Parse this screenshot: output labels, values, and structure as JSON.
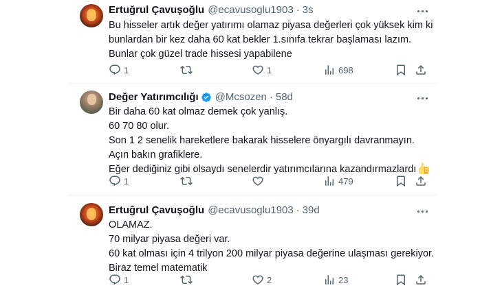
{
  "tweets": [
    {
      "name": "Ertuğrul Çavuşoğlu",
      "handle": "@ecavusoglu1903",
      "separator": "·",
      "time": "3s",
      "verified": false,
      "lines": [
        "Bu hisseler artık değer yatırımı olamaz piyasa değerleri çok yüksek kim ki",
        "bunlardan bir kez daha 60 kat bekler 1.sınıfa tekrar başlaması lazım.",
        "Bunlar çok güzel trade hissesi yapabilene"
      ],
      "replies": "1",
      "retweets": "",
      "likes": "1",
      "views": "698"
    },
    {
      "name": "Değer Yatırımcılığı",
      "handle": "@Mcsozen",
      "separator": "·",
      "time": "58d",
      "verified": true,
      "lines": [
        "Bir daha 60 kat olmaz demek çok yanlış.",
        "60 70 80 olur.",
        "Son 1 2 senelik hareketlere bakarak hisselere önyargılı davranmayın.",
        "Açın bakın grafiklere.",
        "Eğer dediğiniz gibi olsaydı senelerdir yatırımcılarına kazandırmazlardı"
      ],
      "emoji": "thumbs-up",
      "replies": "1",
      "retweets": "",
      "likes": "",
      "views": "479"
    },
    {
      "name": "Ertuğrul Çavuşoğlu",
      "handle": "@ecavusoglu1903",
      "separator": "·",
      "time": "39d",
      "verified": false,
      "lines": [
        "OLAMAZ.",
        "70 milyar piyasa değeri var.",
        "60 kat olması için 4 trilyon 200 milyar piyasa değerine ulaşması gerekiyor.",
        "Biraz temel matematik"
      ],
      "replies": "1",
      "retweets": "",
      "likes": "2",
      "views": "23"
    }
  ],
  "icons": {
    "more": "more-icon",
    "reply": "reply-icon",
    "retweet": "retweet-icon",
    "like": "like-icon",
    "views": "views-icon",
    "bookmark": "bookmark-icon",
    "share": "share-icon",
    "verified": "verified-badge-icon"
  },
  "colors": {
    "text": "#0f1419",
    "secondary": "#536471",
    "verified": "#1d9bf0",
    "separator": "#eff3f4"
  }
}
